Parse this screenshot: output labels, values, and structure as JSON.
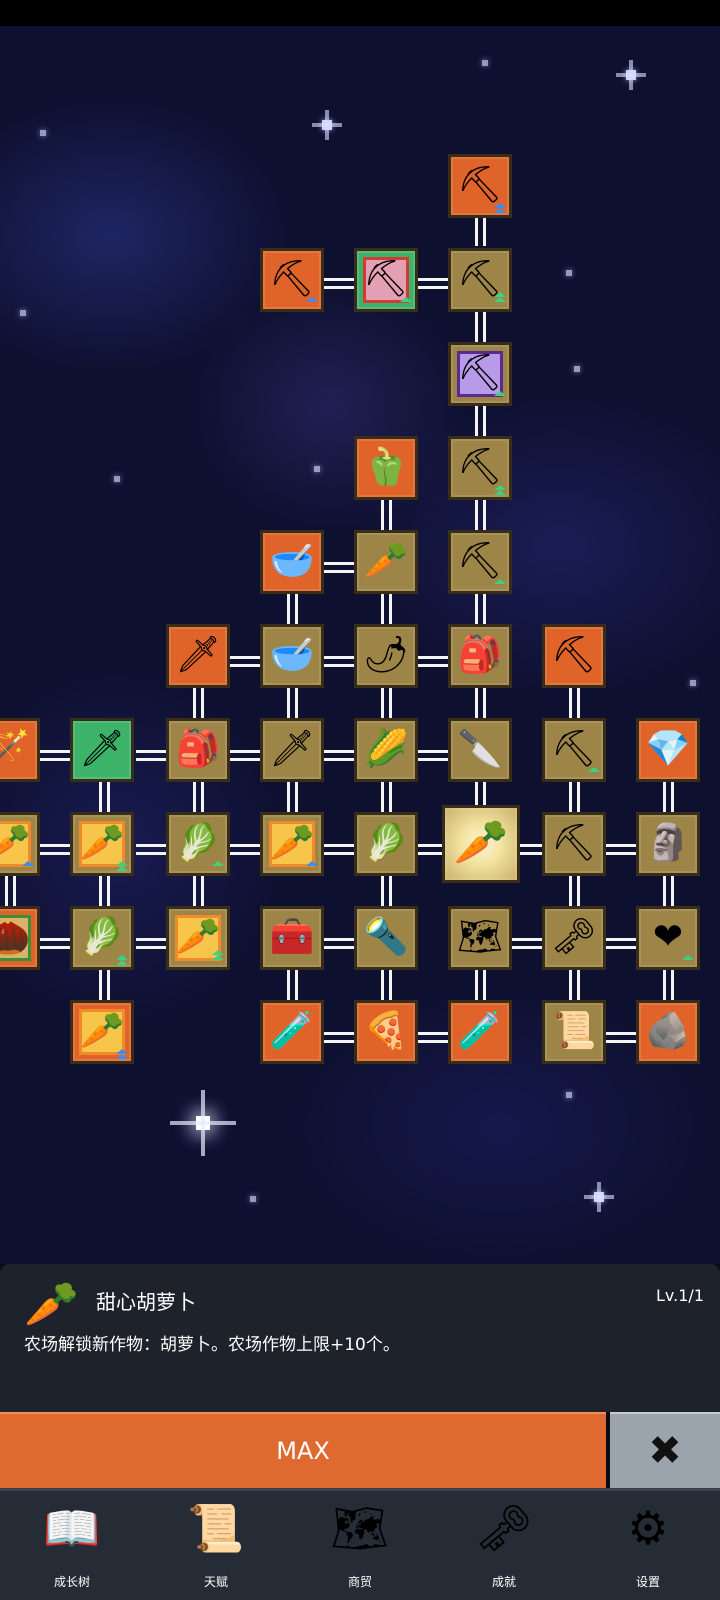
{
  "skill_tree": {
    "nodes": [
      {
        "id": "n-shovel-top",
        "icon": "shovel-icon",
        "style": "orange",
        "upgrade": "blue-double",
        "glyph": "⛏"
      },
      {
        "id": "n-shovel-l2a",
        "icon": "shovel-icon",
        "style": "orange",
        "upgrade": "blue-single",
        "glyph": "⛏"
      },
      {
        "id": "n-shovel-l2b",
        "icon": "shovel-icon",
        "style": "green-framed-red",
        "upgrade": "green-single",
        "glyph": "⛏"
      },
      {
        "id": "n-shovel-l2c",
        "icon": "shovel-icon",
        "style": "gold",
        "upgrade": "green-triple",
        "glyph": "⛏"
      },
      {
        "id": "n-shovel-purple",
        "icon": "shovel-icon",
        "style": "gold-framed-purple",
        "upgrade": "green-single",
        "glyph": "⛏"
      },
      {
        "id": "n-pepper",
        "icon": "bell-pepper-icon",
        "style": "orange",
        "glyph": "🫑"
      },
      {
        "id": "n-shovel-l4",
        "icon": "shovel-icon",
        "style": "gold",
        "upgrade": "green-double",
        "glyph": "⛏"
      },
      {
        "id": "n-bowl-soup",
        "icon": "soup-bowl-icon",
        "style": "orange",
        "glyph": "🥣"
      },
      {
        "id": "n-radish",
        "icon": "radish-icon",
        "style": "gold",
        "glyph": "🥕"
      },
      {
        "id": "n-shovel-l5",
        "icon": "shovel-icon",
        "style": "gold",
        "upgrade": "green-single",
        "glyph": "⛏"
      },
      {
        "id": "n-sword-gold",
        "icon": "sword-icon",
        "style": "orange",
        "glyph": "🗡"
      },
      {
        "id": "n-bowl",
        "icon": "bowl-icon",
        "style": "gold",
        "glyph": "🥣"
      },
      {
        "id": "n-chili",
        "icon": "chili-icon",
        "style": "gold",
        "glyph": "🌶"
      },
      {
        "id": "n-backpack",
        "icon": "backpack-icon",
        "style": "gold",
        "glyph": "🎒"
      },
      {
        "id": "n-pickaxe-green",
        "icon": "pickaxe-icon",
        "style": "orange",
        "glyph": "⛏"
      }
    ]
  },
  "selected_skill": {
    "icon": "carrot-icon",
    "name": "甜心胡萝卜",
    "level": "Lv.1/1",
    "description": "农场解锁新作物：胡萝卜。农场作物上限+10个。"
  },
  "actions": {
    "max_label": "MAX",
    "close_label": "✖"
  },
  "nav": {
    "items": [
      {
        "label": "成长树",
        "icon": "book-icon"
      },
      {
        "label": "天赋",
        "icon": "scroll-icon"
      },
      {
        "label": "商贸",
        "icon": "map-icon"
      },
      {
        "label": "成就",
        "icon": "key-icon"
      },
      {
        "label": "设置",
        "icon": "gear-icon"
      }
    ]
  },
  "colors": {
    "accent_orange": "#df6a2f",
    "node_gold": "#9d8447",
    "node_orange": "#e0632a",
    "node_green": "#3db36a",
    "panel_bg": "#1d222b",
    "space_bg": "#0e1030"
  }
}
